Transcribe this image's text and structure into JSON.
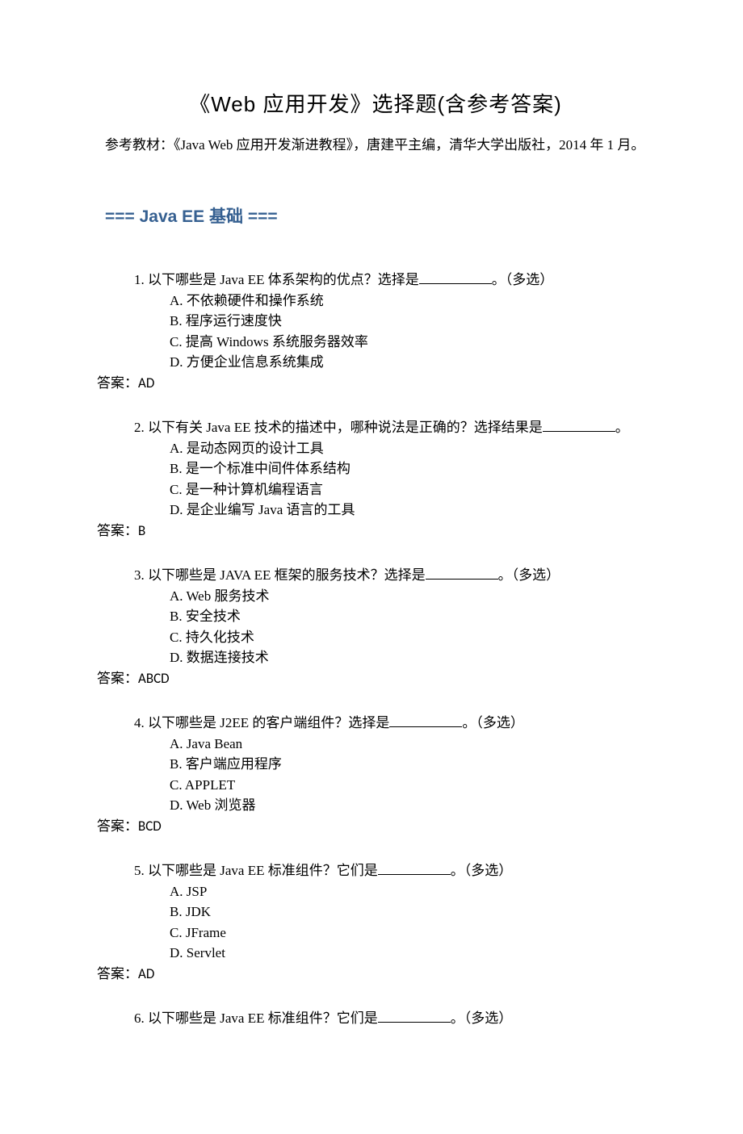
{
  "title": "《Web 应用开发》选择题(含参考答案)",
  "reference": "参考教材：《Java Web 应用开发渐进教程》，唐建平主编，清华大学出版社，2014 年 1 月。",
  "section_header": "=== Java EE 基础 ===",
  "answer_prefix": "答案：",
  "questions": [
    {
      "num": "1.",
      "text_before": "以下哪些是 Java EE 体系架构的优点？选择是",
      "text_after": "。（多选）",
      "options": [
        "A.  不依赖硬件和操作系统",
        "B.  程序运行速度快",
        "C.  提高 Windows 系统服务器效率",
        "D.  方便企业信息系统集成"
      ],
      "answer": "AD"
    },
    {
      "num": "2.",
      "text_before": "以下有关 Java   EE 技术的描述中，哪种说法是正确的？选择结果是",
      "text_after": "。",
      "options": [
        "A.  是动态网页的设计工具",
        "B.  是一个标准中间件体系结构",
        "C.  是一种计算机编程语言",
        "D.  是企业编写 Java 语言的工具"
      ],
      "answer": "B"
    },
    {
      "num": "3.",
      "text_before": "以下哪些是 JAVA EE 框架的服务技术？选择是",
      "text_after": "。（多选）",
      "options": [
        "A. Web 服务技术",
        "B.  安全技术",
        "C.  持久化技术",
        "D.  数据连接技术"
      ],
      "answer": "ABCD"
    },
    {
      "num": "4.",
      "text_before": "以下哪些是 J2EE 的客户端组件？选择是",
      "text_after": "。（多选）",
      "options": [
        "A. Java Bean",
        "B.  客户端应用程序",
        "C. APPLET",
        "D. Web 浏览器"
      ],
      "answer": "BCD"
    },
    {
      "num": "5.",
      "text_before": "以下哪些是 Java EE 标准组件？它们是",
      "text_after": "。（多选）",
      "options": [
        "A. JSP",
        "B. JDK",
        "C. JFrame",
        "D. Servlet"
      ],
      "answer": "AD"
    },
    {
      "num": "6.",
      "text_before": "以下哪些是 Java EE 标准组件？它们是",
      "text_after": "。（多选）",
      "options": [],
      "answer": null
    }
  ]
}
